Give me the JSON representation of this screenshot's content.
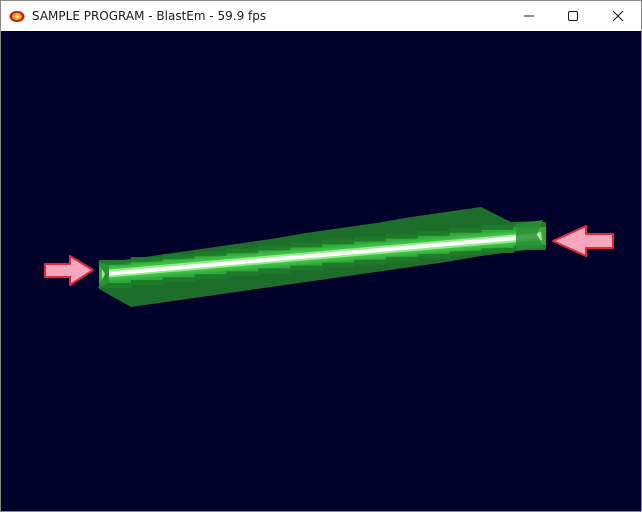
{
  "window": {
    "title": "SAMPLE PROGRAM - BlastEm - 59.9 fps",
    "icon": "blastem-app-icon",
    "controls": [
      "minimize-icon",
      "maximize-icon",
      "close-icon"
    ]
  },
  "colors": {
    "viewport_background": "#00002a",
    "beam_outer": "#1f7a2a",
    "beam_mid": "#3fc04a",
    "beam_core": "#ffffff",
    "arrow_fill": "#f7a7bd",
    "arrow_stroke": "#e0283c"
  }
}
